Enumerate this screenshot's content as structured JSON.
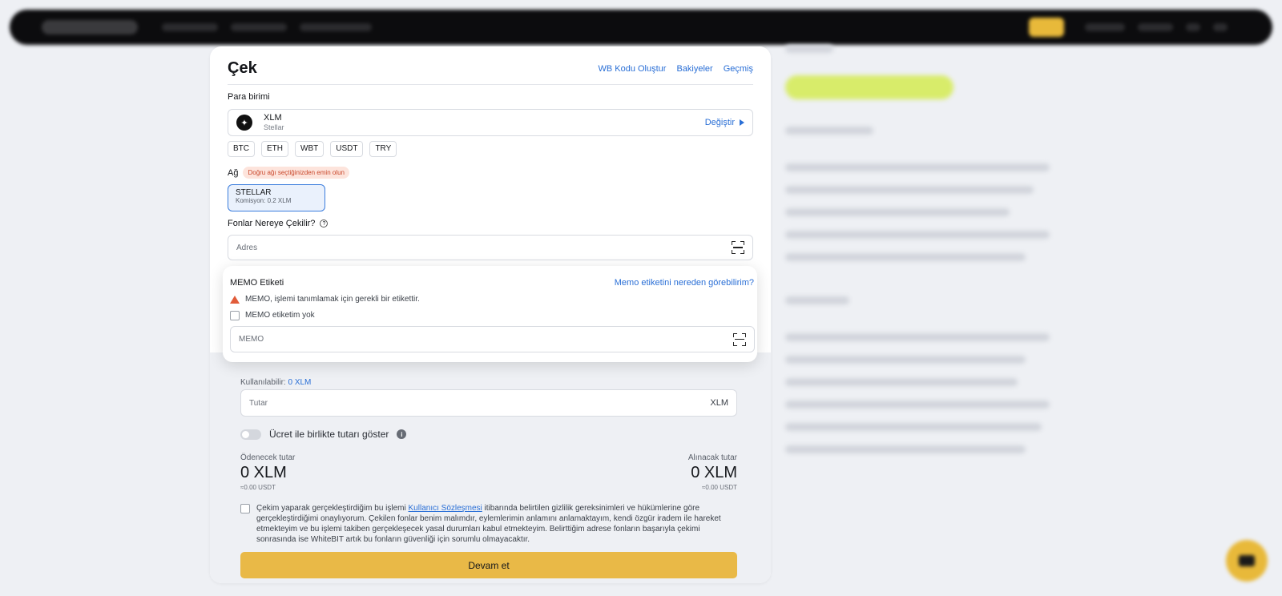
{
  "page": {
    "title": "Çek",
    "header_links": [
      "WB Kodu Oluştur",
      "Bakiyeler",
      "Geçmiş"
    ]
  },
  "currency": {
    "label": "Para birimi",
    "selected_code": "XLM",
    "selected_name": "Stellar",
    "change_label": "Değiştir",
    "quick_chips": [
      "BTC",
      "ETH",
      "WBT",
      "USDT",
      "TRY"
    ]
  },
  "network": {
    "label": "Ağ",
    "warning": "Doğru ağı seçtiğinizden emin olun",
    "selected_name": "STELLAR",
    "selected_fee": "Komisyon: 0.2 XLM"
  },
  "destination": {
    "label": "Fonlar Nereye Çekilir?",
    "address_placeholder": "Adres"
  },
  "memo": {
    "title": "MEMO Etiketi",
    "help_link": "Memo etiketini nereden görebilirim?",
    "warning": "MEMO, işlemi tanımlamak için gerekli bir etikettir.",
    "no_memo_label": "MEMO etiketim yok",
    "placeholder": "MEMO"
  },
  "amount": {
    "available_label": "Kullanılabilir:",
    "available_value": "0 XLM",
    "placeholder": "Tutar",
    "unit": "XLM",
    "toggle_label": "Ücret ile birlikte tutarı göster"
  },
  "summary": {
    "pay_label": "Ödenecek tutar",
    "pay_value": "0 XLM",
    "pay_sub": "≈0.00 USDT",
    "receive_label": "Alınacak tutar",
    "receive_value": "0 XLM",
    "receive_sub": "≈0.00 USDT"
  },
  "consent": {
    "before": "Çekim yaparak gerçekleştirdiğim bu işlemi ",
    "link": "Kullanıcı Sözleşmesi",
    "after": " itibarında belirtilen gizlilik gereksinimleri ve hükümlerine göre gerçekleştirdiğimi onaylıyorum. Çekilen fonlar benim malımdır, eylemlerimin anlamını anlamaktayım, kendi özgür iradem ile hareket etmekteyim ve bu işlemi takiben gerçekleşecek yasal durumları kabul etmekteyim. Belirttiğim adrese fonların başarıyla çekimi sonrasında ise WhiteBIT artık bu fonların güvenliği için sorumlu olmayacaktır."
  },
  "continue_label": "Devam et",
  "colors": {
    "accent_link": "#2a6fd6",
    "primary_button": "#e9b947",
    "warning": "#e15c3a",
    "network_selected_bg": "#eaf1fc"
  }
}
